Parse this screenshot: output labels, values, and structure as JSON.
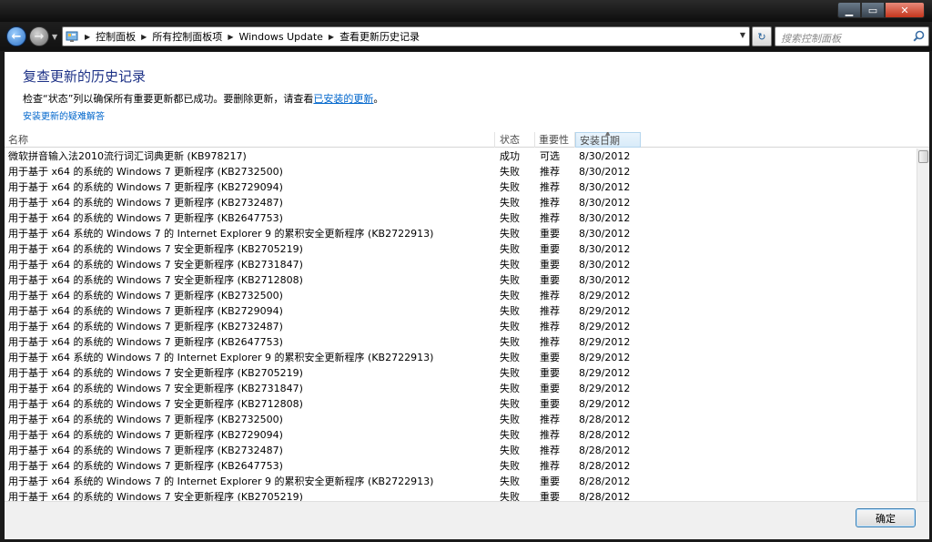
{
  "window": {
    "min_glyph": "▁",
    "max_glyph": "▭",
    "close_glyph": "✕"
  },
  "nav": {
    "back_glyph": "←",
    "forward_glyph": "→",
    "dropdown_glyph": "▼",
    "breadcrumb": [
      "控制面板",
      "所有控制面板项",
      "Windows Update",
      "查看更新历史记录"
    ],
    "crumb_separator": "▶",
    "refresh_glyph": "↻",
    "search_placeholder": "搜索控制面板"
  },
  "page": {
    "title": "复查更新的历史记录",
    "description_prefix": "检查“状态”列以确保所有重要更新都已成功。要删除更新，请查看",
    "description_link": "已安装的更新",
    "description_suffix": "。",
    "troubleshoot_link": "安装更新的疑难解答"
  },
  "table": {
    "headers": {
      "name": "名称",
      "status": "状态",
      "importance": "重要性",
      "date": "安装日期"
    },
    "sort_glyph": "▲",
    "rows": [
      [
        "微软拼音输入法2010流行词汇词典更新 (KB978217)",
        "成功",
        "可选",
        "8/30/2012"
      ],
      [
        "用于基于 x64 的系统的 Windows 7 更新程序 (KB2732500)",
        "失败",
        "推荐",
        "8/30/2012"
      ],
      [
        "用于基于 x64 的系统的 Windows 7 更新程序 (KB2729094)",
        "失败",
        "推荐",
        "8/30/2012"
      ],
      [
        "用于基于 x64 的系统的 Windows 7 更新程序 (KB2732487)",
        "失败",
        "推荐",
        "8/30/2012"
      ],
      [
        "用于基于 x64 的系统的 Windows 7 更新程序 (KB2647753)",
        "失败",
        "推荐",
        "8/30/2012"
      ],
      [
        "用于基于 x64 系统的 Windows 7 的 Internet Explorer 9 的累积安全更新程序 (KB2722913)",
        "失败",
        "重要",
        "8/30/2012"
      ],
      [
        "用于基于 x64 的系统的 Windows 7 安全更新程序 (KB2705219)",
        "失败",
        "重要",
        "8/30/2012"
      ],
      [
        "用于基于 x64 的系统的 Windows 7 安全更新程序 (KB2731847)",
        "失败",
        "重要",
        "8/30/2012"
      ],
      [
        "用于基于 x64 的系统的 Windows 7 安全更新程序 (KB2712808)",
        "失败",
        "重要",
        "8/30/2012"
      ],
      [
        "用于基于 x64 的系统的 Windows 7 更新程序 (KB2732500)",
        "失败",
        "推荐",
        "8/29/2012"
      ],
      [
        "用于基于 x64 的系统的 Windows 7 更新程序 (KB2729094)",
        "失败",
        "推荐",
        "8/29/2012"
      ],
      [
        "用于基于 x64 的系统的 Windows 7 更新程序 (KB2732487)",
        "失败",
        "推荐",
        "8/29/2012"
      ],
      [
        "用于基于 x64 的系统的 Windows 7 更新程序 (KB2647753)",
        "失败",
        "推荐",
        "8/29/2012"
      ],
      [
        "用于基于 x64 系统的 Windows 7 的 Internet Explorer 9 的累积安全更新程序 (KB2722913)",
        "失败",
        "重要",
        "8/29/2012"
      ],
      [
        "用于基于 x64 的系统的 Windows 7 安全更新程序 (KB2705219)",
        "失败",
        "重要",
        "8/29/2012"
      ],
      [
        "用于基于 x64 的系统的 Windows 7 安全更新程序 (KB2731847)",
        "失败",
        "重要",
        "8/29/2012"
      ],
      [
        "用于基于 x64 的系统的 Windows 7 安全更新程序 (KB2712808)",
        "失败",
        "重要",
        "8/29/2012"
      ],
      [
        "用于基于 x64 的系统的 Windows 7 更新程序 (KB2732500)",
        "失败",
        "推荐",
        "8/28/2012"
      ],
      [
        "用于基于 x64 的系统的 Windows 7 更新程序 (KB2729094)",
        "失败",
        "推荐",
        "8/28/2012"
      ],
      [
        "用于基于 x64 的系统的 Windows 7 更新程序 (KB2732487)",
        "失败",
        "推荐",
        "8/28/2012"
      ],
      [
        "用于基于 x64 的系统的 Windows 7 更新程序 (KB2647753)",
        "失败",
        "推荐",
        "8/28/2012"
      ],
      [
        "用于基于 x64 系统的 Windows 7 的 Internet Explorer 9 的累积安全更新程序 (KB2722913)",
        "失败",
        "重要",
        "8/28/2012"
      ],
      [
        "用于基于 x64 的系统的 Windows 7 安全更新程序 (KB2705219)",
        "失败",
        "重要",
        "8/28/2012"
      ]
    ]
  },
  "footer": {
    "ok_label": "确定"
  },
  "colors": {
    "title": "#1e3287",
    "link": "#0066cc"
  }
}
